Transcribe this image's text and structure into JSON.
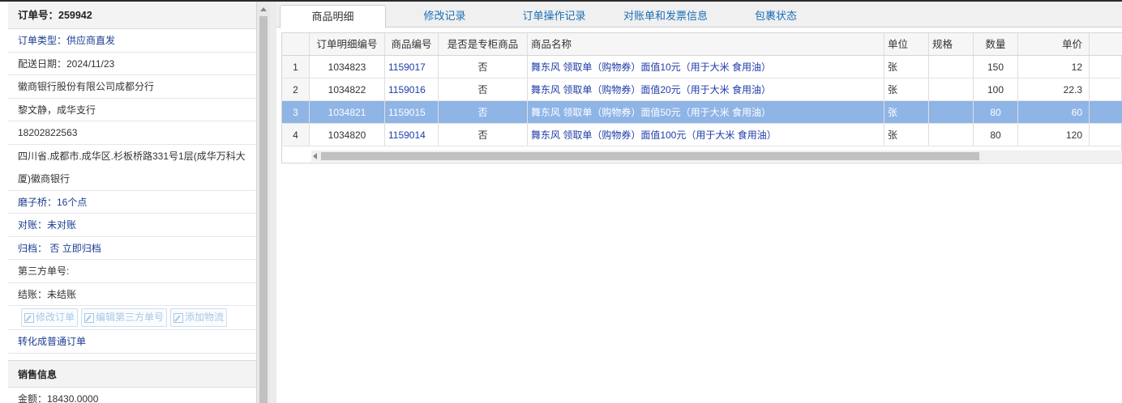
{
  "order_panel": {
    "header": "订单号：259942",
    "type": "订单类型：供应商直发",
    "delivery_date": "配送日期：2024/11/23",
    "customer": "徽商银行股份有限公司成都分行",
    "contact": "黎文静，成华支行",
    "phone": "18202822563",
    "address": "四川省.成都市.成华区.杉板桥路331号1层(成华万科大厦)徽商银行",
    "station": "磨子桥：16个点",
    "reconcile": "对账：未对账",
    "archive": "归档：",
    "archive_value": "否 立即归档",
    "third_party_no": "第三方单号:",
    "settlement": "结账：未结账",
    "buttons": {
      "edit_order": "修改订单",
      "edit_third_party": "编辑第三方单号",
      "add_logistics": "添加物流"
    },
    "convert_link": "转化成普通订单",
    "sales_section": "销售信息",
    "amount": "金额：18430.0000"
  },
  "tabs": [
    {
      "label": "商品明细"
    },
    {
      "label": "修改记录"
    },
    {
      "label": "订单操作记录"
    },
    {
      "label": "对账单和发票信息"
    },
    {
      "label": "包裹状态"
    }
  ],
  "table": {
    "columns": [
      "订单明细编号",
      "商品编号",
      "是否是专柜商品",
      "商品名称",
      "单位",
      "规格",
      "数量",
      "单价"
    ],
    "rows": [
      {
        "n": "1",
        "detail_id": "1034823",
        "product_id": "1159017",
        "counter": "否",
        "name": "舞东风 领取单（购物券）面值10元（用于大米 食用油）",
        "unit": "张",
        "spec": "",
        "qty": "150",
        "price": "12"
      },
      {
        "n": "2",
        "detail_id": "1034822",
        "product_id": "1159016",
        "counter": "否",
        "name": "舞东风 领取单（购物券）面值20元（用于大米 食用油）",
        "unit": "张",
        "spec": "",
        "qty": "100",
        "price": "22.3"
      },
      {
        "n": "3",
        "detail_id": "1034821",
        "product_id": "1159015",
        "counter": "否",
        "name": "舞东风 领取单（购物券）面值50元（用于大米 食用油）",
        "unit": "张",
        "spec": "",
        "qty": "80",
        "price": "60"
      },
      {
        "n": "4",
        "detail_id": "1034820",
        "product_id": "1159014",
        "counter": "否",
        "name": "舞东风 领取单（购物券）面值100元（用于大米 食用油）",
        "unit": "张",
        "spec": "",
        "qty": "80",
        "price": "120"
      }
    ],
    "selected_row": 2
  }
}
